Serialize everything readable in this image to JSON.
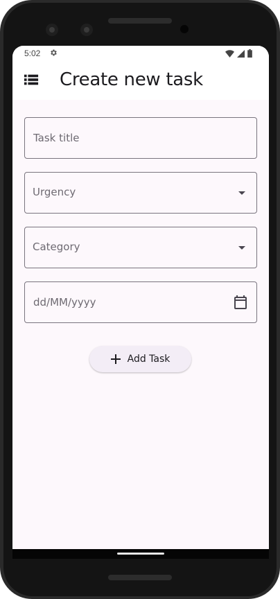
{
  "status_bar": {
    "time": "5:02"
  },
  "app_bar": {
    "title": "Create new task"
  },
  "form": {
    "task_title_placeholder": "Task title",
    "urgency_placeholder": "Urgency",
    "category_placeholder": "Category",
    "date_placeholder": "dd/MM/yyyy"
  },
  "actions": {
    "add_task_label": "Add Task"
  },
  "icons": {
    "menu": "list-icon",
    "settings": "gear-icon",
    "wifi": "wifi-icon",
    "signal": "signal-icon",
    "battery": "battery-icon",
    "dropdown": "chevron-down-icon",
    "calendar": "calendar-icon",
    "plus": "plus-icon"
  },
  "colors": {
    "background": "#fdf8fc",
    "outline": "#79747e",
    "button_bg": "#f3edf6",
    "text": "#1c1b1f",
    "placeholder": "#6e6a72"
  }
}
